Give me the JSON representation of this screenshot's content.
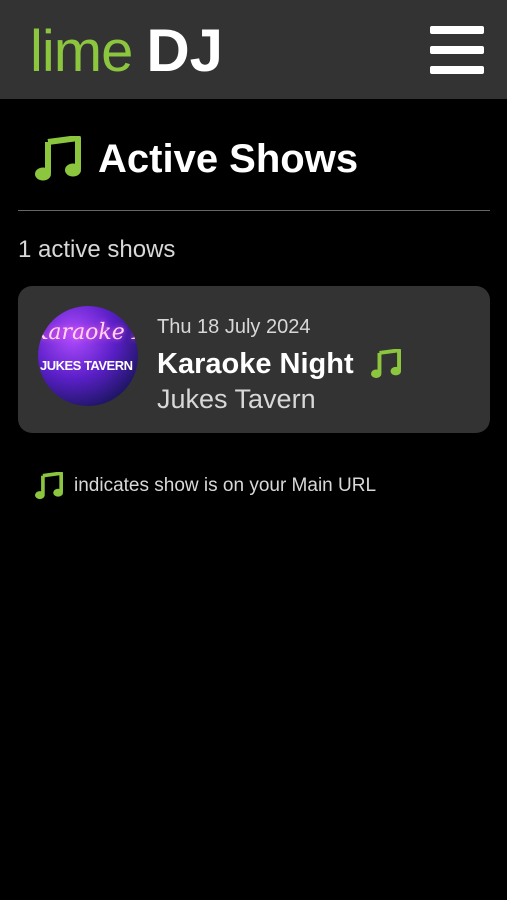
{
  "header": {
    "logo_lime": "lime",
    "logo_dj": "DJ",
    "menu_icon": "hamburger-menu-icon"
  },
  "page": {
    "title": "Active Shows",
    "title_icon": "music-note-icon",
    "count_text": "1 active shows"
  },
  "shows": [
    {
      "image_text_top": "Karaoke Night",
      "image_text_bottom": "JUKES TAVERN",
      "date": "Thu 18 July 2024",
      "title": "Karaoke Night",
      "venue": "Jukes Tavern",
      "main_url_icon": "music-note-icon"
    }
  ],
  "legend": {
    "icon": "music-note-icon",
    "text": "indicates show is on your Main URL"
  },
  "colors": {
    "accent": "#8cc63f",
    "header_bg": "#333333",
    "card_bg": "#333333",
    "background": "#000000"
  }
}
